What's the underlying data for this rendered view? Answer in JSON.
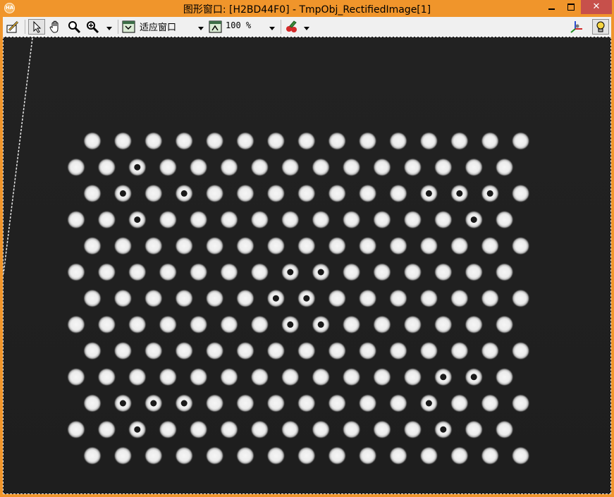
{
  "window": {
    "title": "图形窗口: [H2BD44F0] - TmpObj_RectifiedImage[1]",
    "app_icon_text": "HA",
    "controls": {
      "minimize": "−",
      "maximize": "□",
      "close": "✕"
    }
  },
  "toolbar": {
    "zoom_mode": "适应窗口",
    "zoom_percent": "100 %",
    "tools": [
      "edit-icon",
      "pointer-icon",
      "hand-pan-icon",
      "magnifier-icon",
      "zoom-in-icon",
      "fit-window-icon",
      "zoom-level-icon",
      "color-paint-icon",
      "axes-3d-icon",
      "lightbulb-icon"
    ]
  },
  "image": {
    "name": "TmpObj_RectifiedImage[1]",
    "background_color": "#202020",
    "dot_color": "#f2f2f2",
    "grid": {
      "rows": 13,
      "odd_row_columns": 15,
      "even_row_columns": 15,
      "ring_markers": [
        [
          1,
          2
        ],
        [
          2,
          1
        ],
        [
          2,
          3
        ],
        [
          2,
          11
        ],
        [
          2,
          12
        ],
        [
          2,
          13
        ],
        [
          3,
          2
        ],
        [
          3,
          13
        ],
        [
          5,
          7
        ],
        [
          5,
          8
        ],
        [
          6,
          6
        ],
        [
          6,
          7
        ],
        [
          7,
          7
        ],
        [
          7,
          8
        ],
        [
          9,
          12
        ],
        [
          9,
          13
        ],
        [
          10,
          1
        ],
        [
          10,
          2
        ],
        [
          10,
          3
        ],
        [
          10,
          11
        ],
        [
          11,
          2
        ],
        [
          11,
          12
        ]
      ]
    }
  }
}
